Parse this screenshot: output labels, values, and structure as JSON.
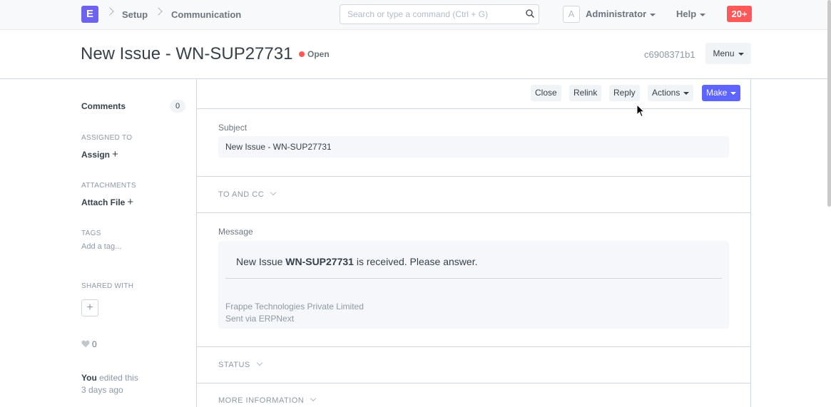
{
  "navbar": {
    "logo_letter": "E",
    "breadcrumbs": [
      "Setup",
      "Communication"
    ],
    "search_placeholder": "Search or type a command (Ctrl + G)",
    "avatar_letter": "A",
    "user_label": "Administrator",
    "help_label": "Help",
    "notifications_count": "20+"
  },
  "header": {
    "title": "New Issue - WN-SUP27731",
    "status": "Open",
    "doc_name": "c6908371b1",
    "menu_label": "Menu"
  },
  "sidebar": {
    "comments_label": "Comments",
    "comments_count": "0",
    "assigned_to_label": "ASSIGNED TO",
    "assign_label": "Assign",
    "attachments_label": "ATTACHMENTS",
    "attach_label": "Attach File",
    "tags_label": "TAGS",
    "add_tag_label": "Add a tag...",
    "shared_with_label": "SHARED WITH",
    "likes_count": "0",
    "edit_actor": "You",
    "edit_action": "edited this",
    "edit_time": "3 days ago"
  },
  "toolbar": {
    "close_label": "Close",
    "relink_label": "Relink",
    "reply_label": "Reply",
    "actions_label": "Actions",
    "make_label": "Make"
  },
  "form": {
    "subject_label": "Subject",
    "subject_value": "New Issue - WN-SUP27731",
    "to_cc_label": "TO AND CC",
    "message_label": "Message",
    "message_pre": "New Issue ",
    "message_bold": "WN-SUP27731",
    "message_post": " is received. Please answer.",
    "footer_line1": "Frappe Technologies Private Limited",
    "footer_line2": "Sent via ERPNext",
    "status_section": "STATUS",
    "more_info_section": "MORE INFORMATION"
  },
  "colors": {
    "accent": "#5e64ff",
    "logo": "#6e63f0",
    "notification": "#ff5858",
    "status_open": "#ff5858"
  }
}
